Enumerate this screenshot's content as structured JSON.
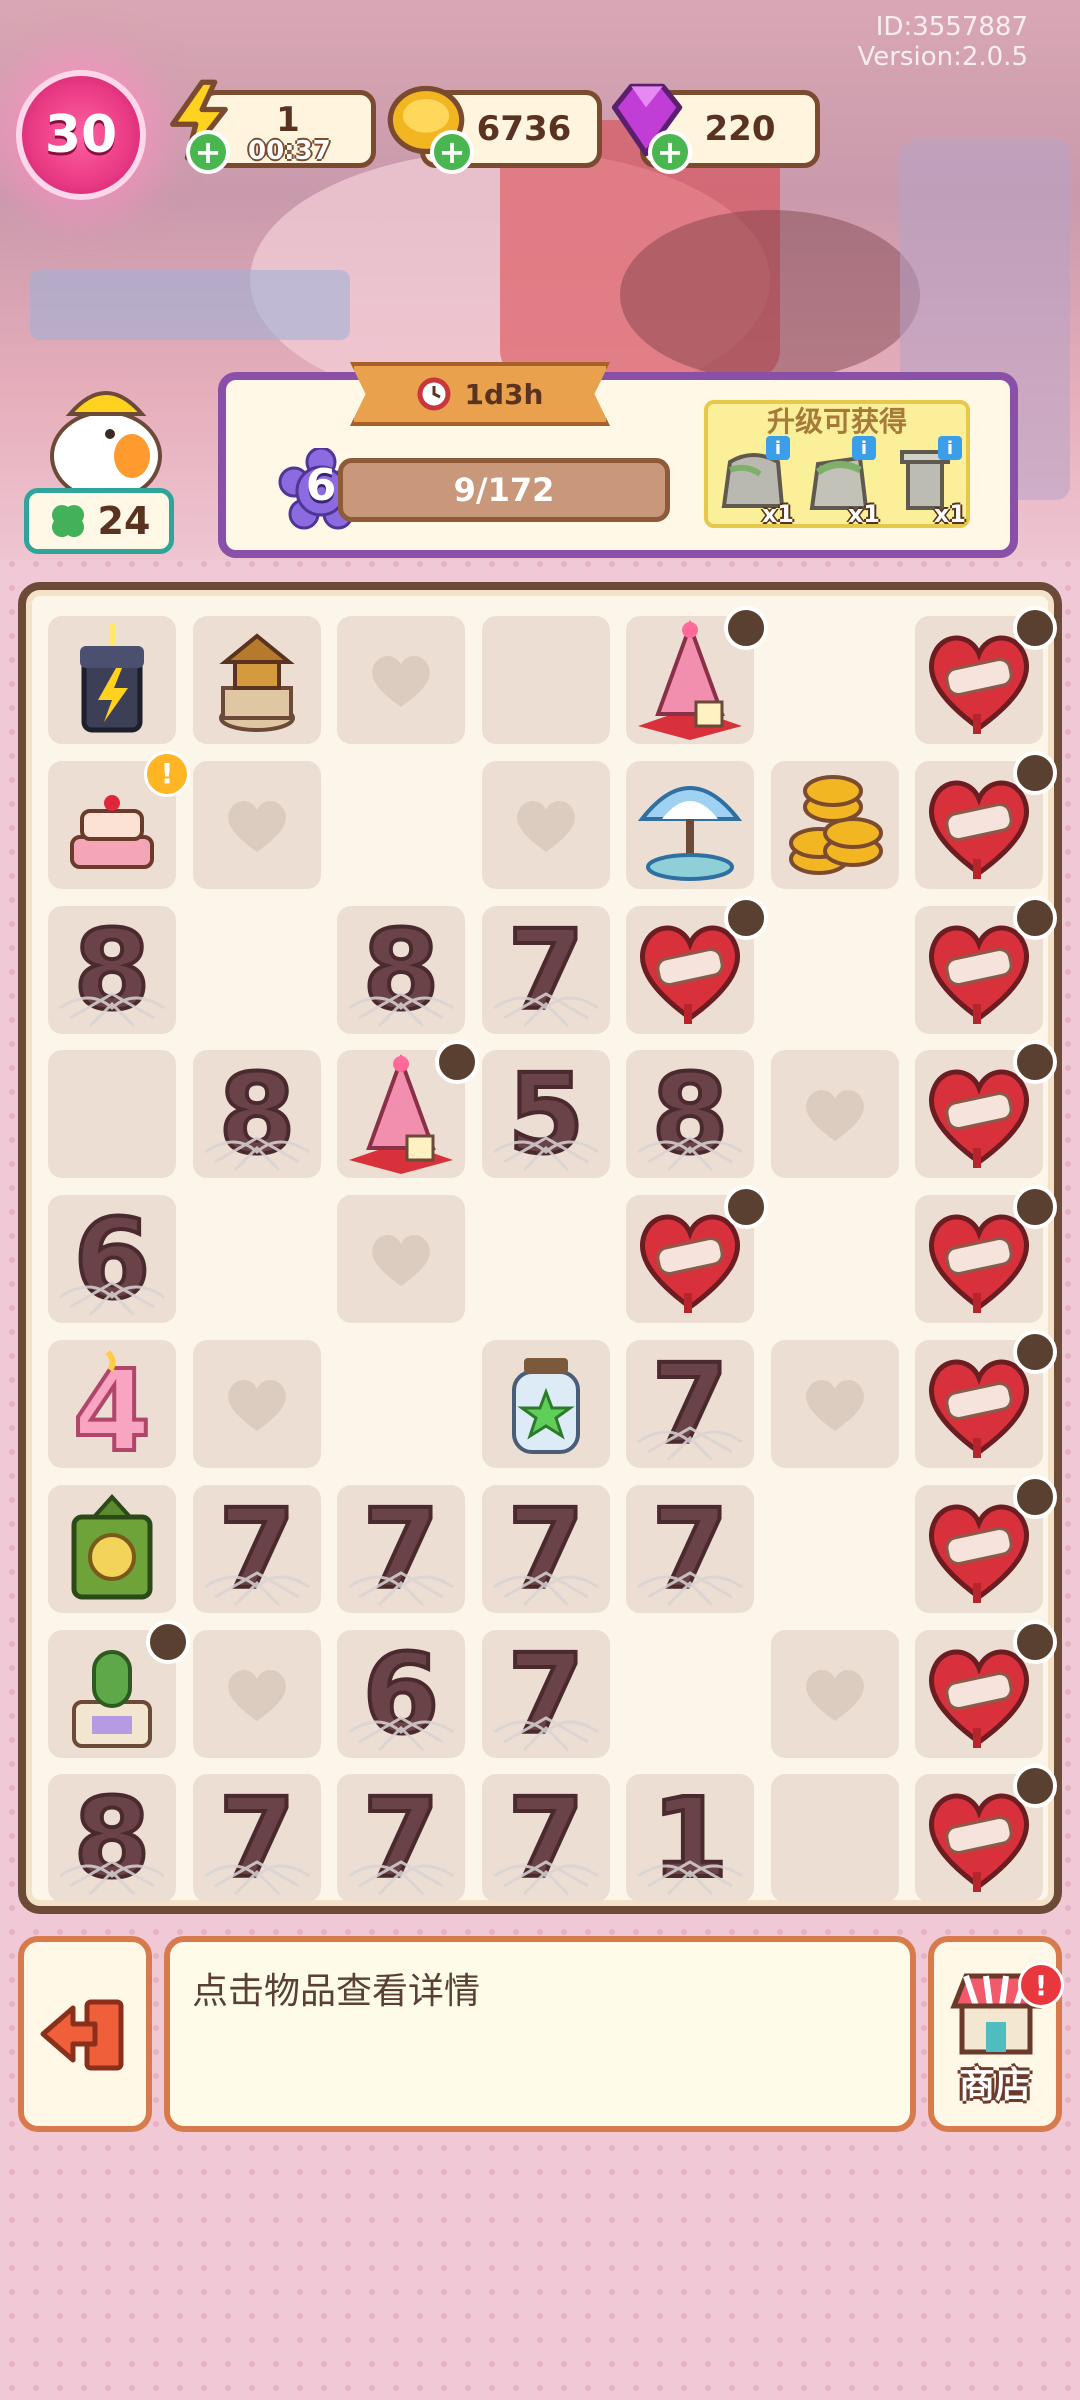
{
  "header": {
    "player_id": "ID:3557887",
    "version": "Version:2.0.5",
    "level": "30",
    "energy": "1",
    "energy_timer": "00:37",
    "coins": "6736",
    "gems": "220"
  },
  "event": {
    "time_left": "1d3h",
    "level": "6",
    "progress": "9/172",
    "reward_title": "升级可获得",
    "rewards": [
      {
        "icon": "stone-statue-icon",
        "qty": "x1"
      },
      {
        "icon": "mossy-stone-icon",
        "qty": "x1"
      },
      {
        "icon": "ruin-pillar-icon",
        "qty": "x1"
      }
    ]
  },
  "clover_count": "24",
  "board": {
    "rows": [
      [
        "lightning-robot",
        "music-box",
        "heart-slot",
        "empty-slot",
        "pink-tree",
        "empty",
        "bandage-heart-timer"
      ],
      [
        "birthday-cake",
        "heart-slot",
        "empty",
        "heart-slot",
        "umbrella-fountain",
        "gold-coins",
        "bandage-heart-timer"
      ],
      [
        "web-8",
        "empty",
        "web-8",
        "web-7",
        "bandage-heart-timer",
        "empty",
        "bandage-heart-timer"
      ],
      [
        "empty-slot",
        "web-8",
        "pink-tree-timer",
        "web-5",
        "web-8",
        "heart-slot",
        "bandage-heart-timer"
      ],
      [
        "web-6",
        "empty",
        "heart-slot",
        "empty",
        "bandage-heart-timer",
        "empty",
        "bandage-heart-timer"
      ],
      [
        "number-4",
        "heart-slot",
        "empty",
        "star-jar",
        "web-7",
        "heart-slot",
        "bandage-heart-timer"
      ],
      [
        "green-lantern",
        "web-7",
        "web-7",
        "web-7",
        "web-7",
        "empty",
        "bandage-heart-timer"
      ],
      [
        "cactus-pot",
        "heart-slot",
        "web-6",
        "web-7",
        "empty",
        "heart-slot",
        "bandage-heart-timer"
      ],
      [
        "web-8",
        "web-7",
        "web-7",
        "web-7",
        "web-1",
        "empty-slot",
        "bandage-heart-timer"
      ]
    ]
  },
  "footer": {
    "info_text": "点击物品查看详情",
    "shop_label": "商店"
  },
  "colors": {
    "accent_pink": "#e93a84",
    "panel_border": "#8a4fa6",
    "board_border": "#6b4a37",
    "button_border": "#d77b4d"
  }
}
